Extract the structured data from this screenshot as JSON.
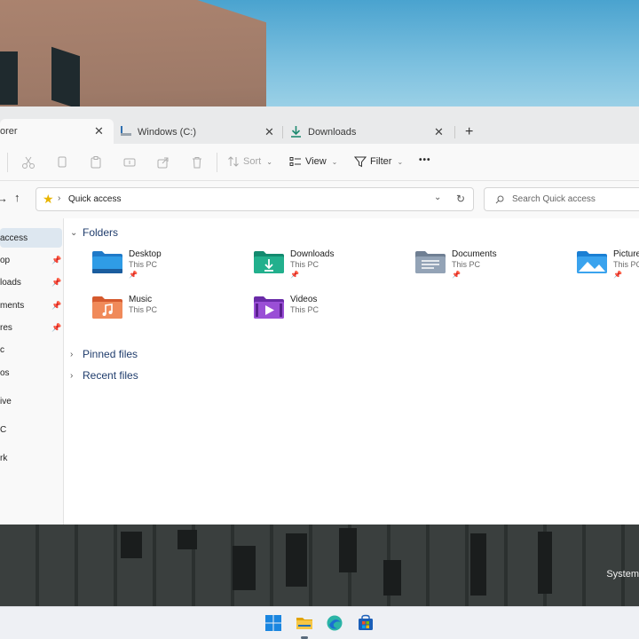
{
  "tabs": [
    {
      "label": "orer",
      "icon": "file-explorer-icon"
    },
    {
      "label": "Windows (C:)",
      "icon": "drive-icon"
    },
    {
      "label": "Downloads",
      "icon": "download-arrow-icon"
    }
  ],
  "toolbar": {
    "sort_label": "Sort",
    "view_label": "View",
    "filter_label": "Filter",
    "more_label": "•••"
  },
  "address": {
    "path_label": "Quick access"
  },
  "search": {
    "placeholder": "Search Quick access"
  },
  "sidebar": {
    "items": [
      {
        "label": "access",
        "selected": true,
        "pinned": false
      },
      {
        "label": "op",
        "pinned": true
      },
      {
        "label": "loads",
        "pinned": true
      },
      {
        "label": "ments",
        "pinned": true
      },
      {
        "label": "res",
        "pinned": true
      },
      {
        "label": "c",
        "pinned": false
      },
      {
        "label": "os",
        "pinned": false
      },
      {
        "label": "ive",
        "pinned": false
      },
      {
        "label": "C",
        "pinned": false
      },
      {
        "label": "rk",
        "pinned": false
      }
    ]
  },
  "content": {
    "folders_heading": "Folders",
    "pinned_heading": "Pinned files",
    "recent_heading": "Recent files",
    "folders": [
      {
        "name": "Desktop",
        "location": "This PC",
        "pinned": true,
        "icon": "desktop-folder-icon"
      },
      {
        "name": "Downloads",
        "location": "This PC",
        "pinned": true,
        "icon": "downloads-folder-icon"
      },
      {
        "name": "Documents",
        "location": "This PC",
        "pinned": true,
        "icon": "documents-folder-icon"
      },
      {
        "name": "Picture",
        "location": "This PC",
        "pinned": true,
        "icon": "pictures-folder-icon"
      },
      {
        "name": "Music",
        "location": "This PC",
        "pinned": false,
        "icon": "music-folder-icon"
      },
      {
        "name": "Videos",
        "location": "This PC",
        "pinned": false,
        "icon": "videos-folder-icon"
      }
    ]
  },
  "desktop": {
    "system_text": "System"
  },
  "colors": {
    "accent": "#0067c0",
    "heading": "#1f3c6c"
  }
}
